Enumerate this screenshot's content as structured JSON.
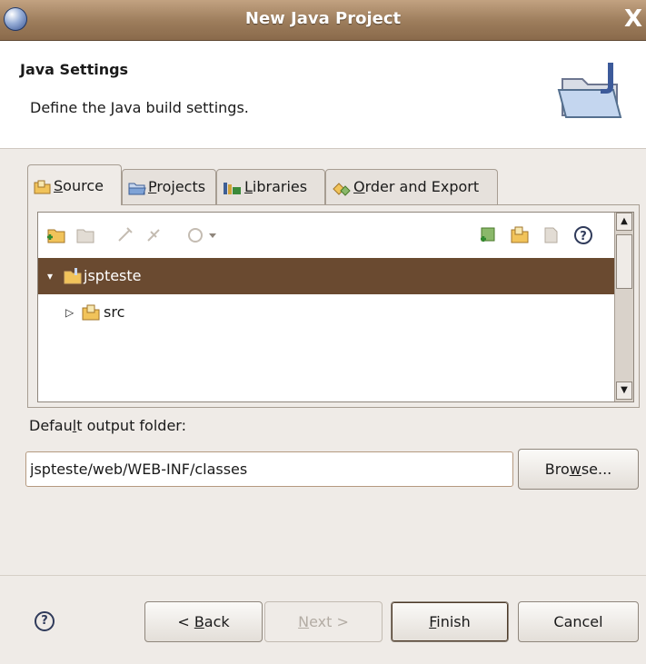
{
  "window": {
    "title": "New Java Project",
    "close_glyph": "X"
  },
  "header": {
    "title": "Java Settings",
    "description": "Define the Java build settings.",
    "icon": "java-folder-wizard-icon"
  },
  "tabs": [
    {
      "label": "Source",
      "mnemonic": "S",
      "rest": "ource",
      "icon": "source-folder-icon",
      "active": true
    },
    {
      "label": "Projects",
      "mnemonic": "P",
      "rest": "rojects",
      "icon": "projects-icon",
      "active": false
    },
    {
      "label": "Libraries",
      "mnemonic": "L",
      "rest": "ibraries",
      "icon": "libraries-icon",
      "active": false
    },
    {
      "label": "Order and Export",
      "mnemonic": "O",
      "rest": "rder and Export",
      "icon": "order-export-icon",
      "active": false
    }
  ],
  "tree": {
    "items": [
      {
        "label": "jspteste",
        "expanded": true,
        "selected": true,
        "icon": "project-folder-icon"
      },
      {
        "label": "src",
        "expanded": false,
        "selected": false,
        "icon": "source-folder-icon"
      }
    ]
  },
  "output": {
    "label_pre": "Defau",
    "label_mnemonic": "l",
    "label_post": "t output folder:",
    "value": "jspteste/web/WEB-INF/classes"
  },
  "buttons": {
    "browse_pre": "Bro",
    "browse_mnemonic": "w",
    "browse_post": "se...",
    "back_pre": "< ",
    "back_mnemonic": "B",
    "back_post": "ack",
    "next_mnemonic": "N",
    "next_post": "ext >",
    "finish_mnemonic": "F",
    "finish_post": "inish",
    "cancel": "Cancel",
    "help_glyph": "?"
  }
}
